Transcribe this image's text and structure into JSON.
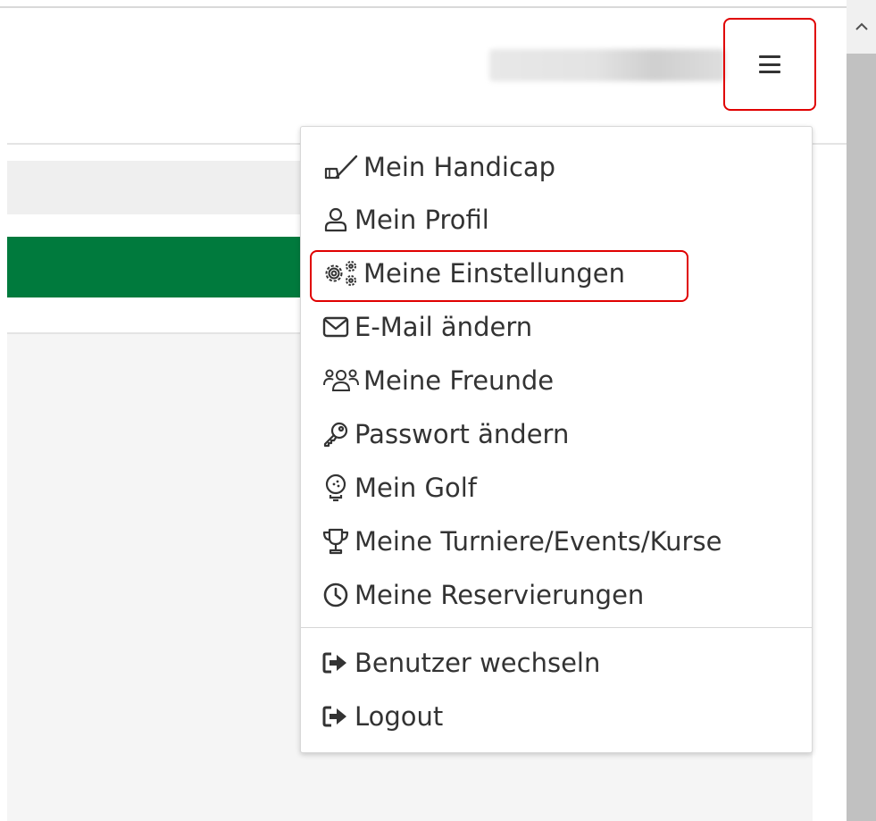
{
  "header": {
    "menu_toggle_icon": "hamburger-icon",
    "scroll_up_icon": "chevron-up-icon"
  },
  "colors": {
    "accent_green": "#007a3d",
    "highlight_red": "#e00000"
  },
  "menu": {
    "items": [
      {
        "label": "Mein Handicap",
        "icon": "golf-club-icon"
      },
      {
        "label": "Mein Profil",
        "icon": "user-icon"
      },
      {
        "label": "Meine Einstellungen",
        "icon": "gears-icon"
      },
      {
        "label": "E-Mail ändern",
        "icon": "envelope-icon"
      },
      {
        "label": "Meine Freunde",
        "icon": "users-icon"
      },
      {
        "label": "Passwort ändern",
        "icon": "key-icon"
      },
      {
        "label": "Mein Golf",
        "icon": "golf-ball-icon"
      },
      {
        "label": "Meine Turniere/Events/Kurse",
        "icon": "trophy-icon"
      },
      {
        "label": "Meine Reservierungen",
        "icon": "clock-icon"
      }
    ],
    "secondary": [
      {
        "label": "Benutzer wechseln",
        "icon": "sign-out-icon"
      },
      {
        "label": "Logout",
        "icon": "sign-out-icon"
      }
    ]
  }
}
